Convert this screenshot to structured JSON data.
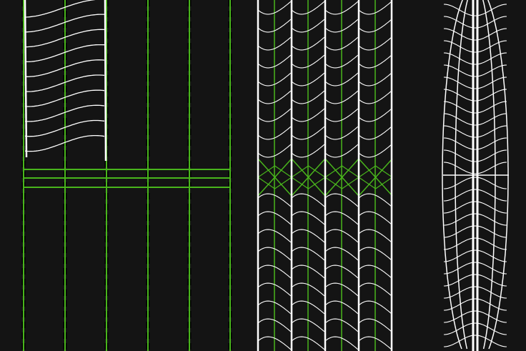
{
  "colors": {
    "background": "#141414",
    "curve": "#ffffff",
    "guide": "#49b51c",
    "tick": "#000000"
  },
  "panels": [
    {
      "id": "left-panel",
      "pattern": "sine-fan-grid"
    },
    {
      "id": "middle-panel",
      "pattern": "repeated-wave-columns"
    },
    {
      "id": "right-panel",
      "pattern": "mirrored-wave-lens"
    }
  ]
}
